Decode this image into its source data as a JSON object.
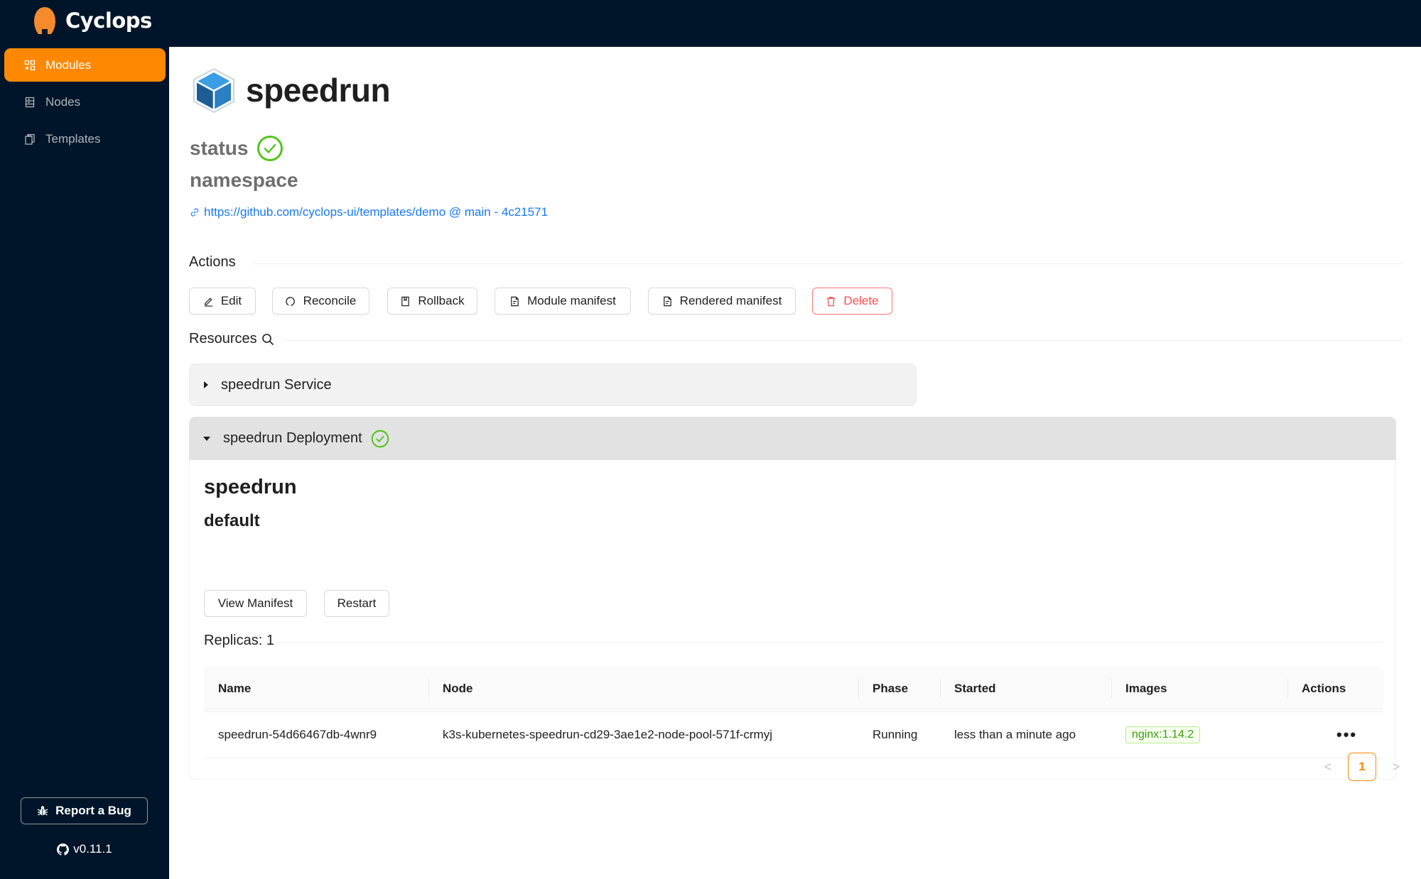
{
  "app": {
    "brand": "Cyclops",
    "accent_color": "#ff8803",
    "header_bg": "#001529"
  },
  "sidebar": {
    "items": [
      {
        "label": "Modules",
        "icon": "modules-icon",
        "active": true
      },
      {
        "label": "Nodes",
        "icon": "nodes-icon",
        "active": false
      },
      {
        "label": "Templates",
        "icon": "templates-icon",
        "active": false
      }
    ],
    "report_bug_label": "Report a Bug",
    "version": "v0.11.1"
  },
  "module": {
    "name": "speedrun",
    "status_label": "status",
    "status": "healthy",
    "namespace_label": "namespace",
    "template_link": "https://github.com/cyclops-ui/templates/demo @ main - 4c21571"
  },
  "actions": {
    "title": "Actions",
    "buttons": [
      {
        "label": "Edit",
        "icon": "edit-icon"
      },
      {
        "label": "Reconcile",
        "icon": "reconcile-icon"
      },
      {
        "label": "Rollback",
        "icon": "rollback-icon"
      },
      {
        "label": "Module manifest",
        "icon": "file-icon"
      },
      {
        "label": "Rendered manifest",
        "icon": "file-icon"
      },
      {
        "label": "Delete",
        "icon": "trash-icon",
        "danger": true
      }
    ]
  },
  "resources": {
    "title": "Resources",
    "items": [
      {
        "label": "speedrun Service",
        "expanded": false
      },
      {
        "label": "speedrun Deployment",
        "expanded": true,
        "status": "healthy",
        "name": "speedrun",
        "namespace": "default",
        "buttons": [
          "View Manifest",
          "Restart"
        ],
        "replicas_label": "Replicas: 1",
        "table": {
          "columns": [
            "Name",
            "Node",
            "Phase",
            "Started",
            "Images",
            "Actions"
          ],
          "rows": [
            {
              "name": "speedrun-54d66467db-4wnr9",
              "node": "k3s-kubernetes-speedrun-cd29-3ae1e2-node-pool-571f-crmyj",
              "phase": "Running",
              "started": "less than a minute ago",
              "image": "nginx:1.14.2",
              "actions": "•••"
            }
          ]
        },
        "pagination": {
          "prev": "<",
          "current": "1",
          "next": ">"
        }
      }
    ]
  }
}
